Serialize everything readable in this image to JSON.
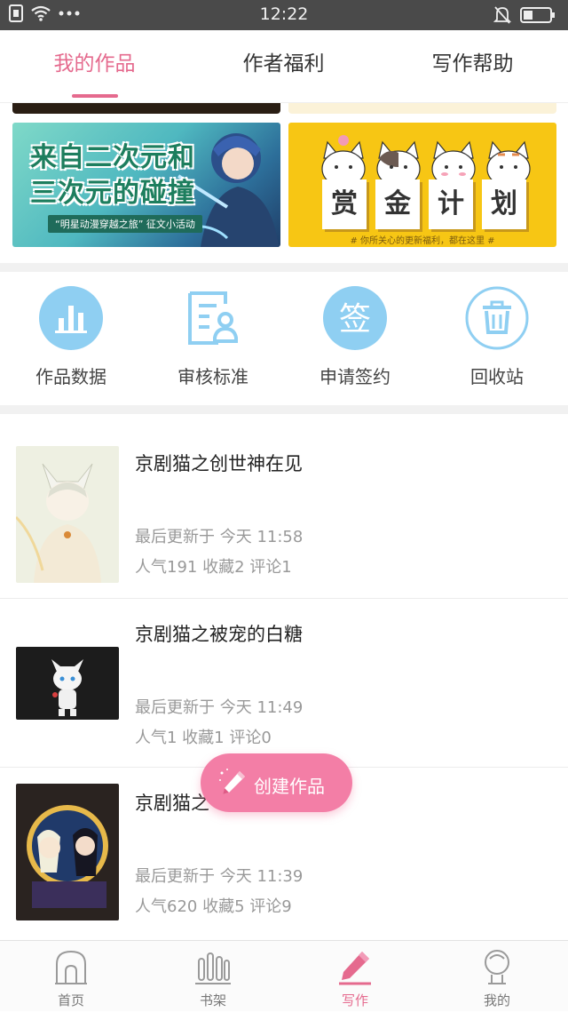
{
  "status_bar": {
    "time": "12:22"
  },
  "tabs": [
    {
      "label": "我的作品",
      "active": true
    },
    {
      "label": "作者福利",
      "active": false
    },
    {
      "label": "写作帮助",
      "active": false
    }
  ],
  "banners": {
    "left": {
      "title_line1": "来自二次元和",
      "title_line2": "三次元的碰撞",
      "subtitle": "“明星动漫穿越之旅” 征文小活动"
    },
    "right": {
      "words": [
        "赏",
        "金",
        "计",
        "划"
      ],
      "subtitle": "# 你所关心的更新福利，都在这里 #"
    }
  },
  "actions": [
    {
      "label": "作品数据",
      "icon": "bar-chart-icon"
    },
    {
      "label": "审核标准",
      "icon": "review-document-icon"
    },
    {
      "label": "申请签约",
      "icon": "sign-contract-icon",
      "glyph": "签"
    },
    {
      "label": "回收站",
      "icon": "trash-icon"
    }
  ],
  "works": [
    {
      "title": "京剧猫之创世神在见",
      "updated": "最后更新于 今天 11:58",
      "stats": "人气191  收藏2  评论1"
    },
    {
      "title": "京剧猫之被宠的白糖",
      "updated": "最后更新于 今天 11:49",
      "stats": "人气1  收藏1  评论0"
    },
    {
      "title": "京剧猫之",
      "updated": "最后更新于 今天 11:39",
      "stats": "人气620  收藏5  评论9"
    }
  ],
  "create_button": {
    "label": "创建作品"
  },
  "bottom_nav": [
    {
      "label": "首页",
      "active": false
    },
    {
      "label": "书架",
      "active": false
    },
    {
      "label": "写作",
      "active": true
    },
    {
      "label": "我的",
      "active": false
    }
  ],
  "colors": {
    "accent": "#e56a8e",
    "icon_blue": "#8fcff2",
    "create_pink": "#f37ea6"
  }
}
